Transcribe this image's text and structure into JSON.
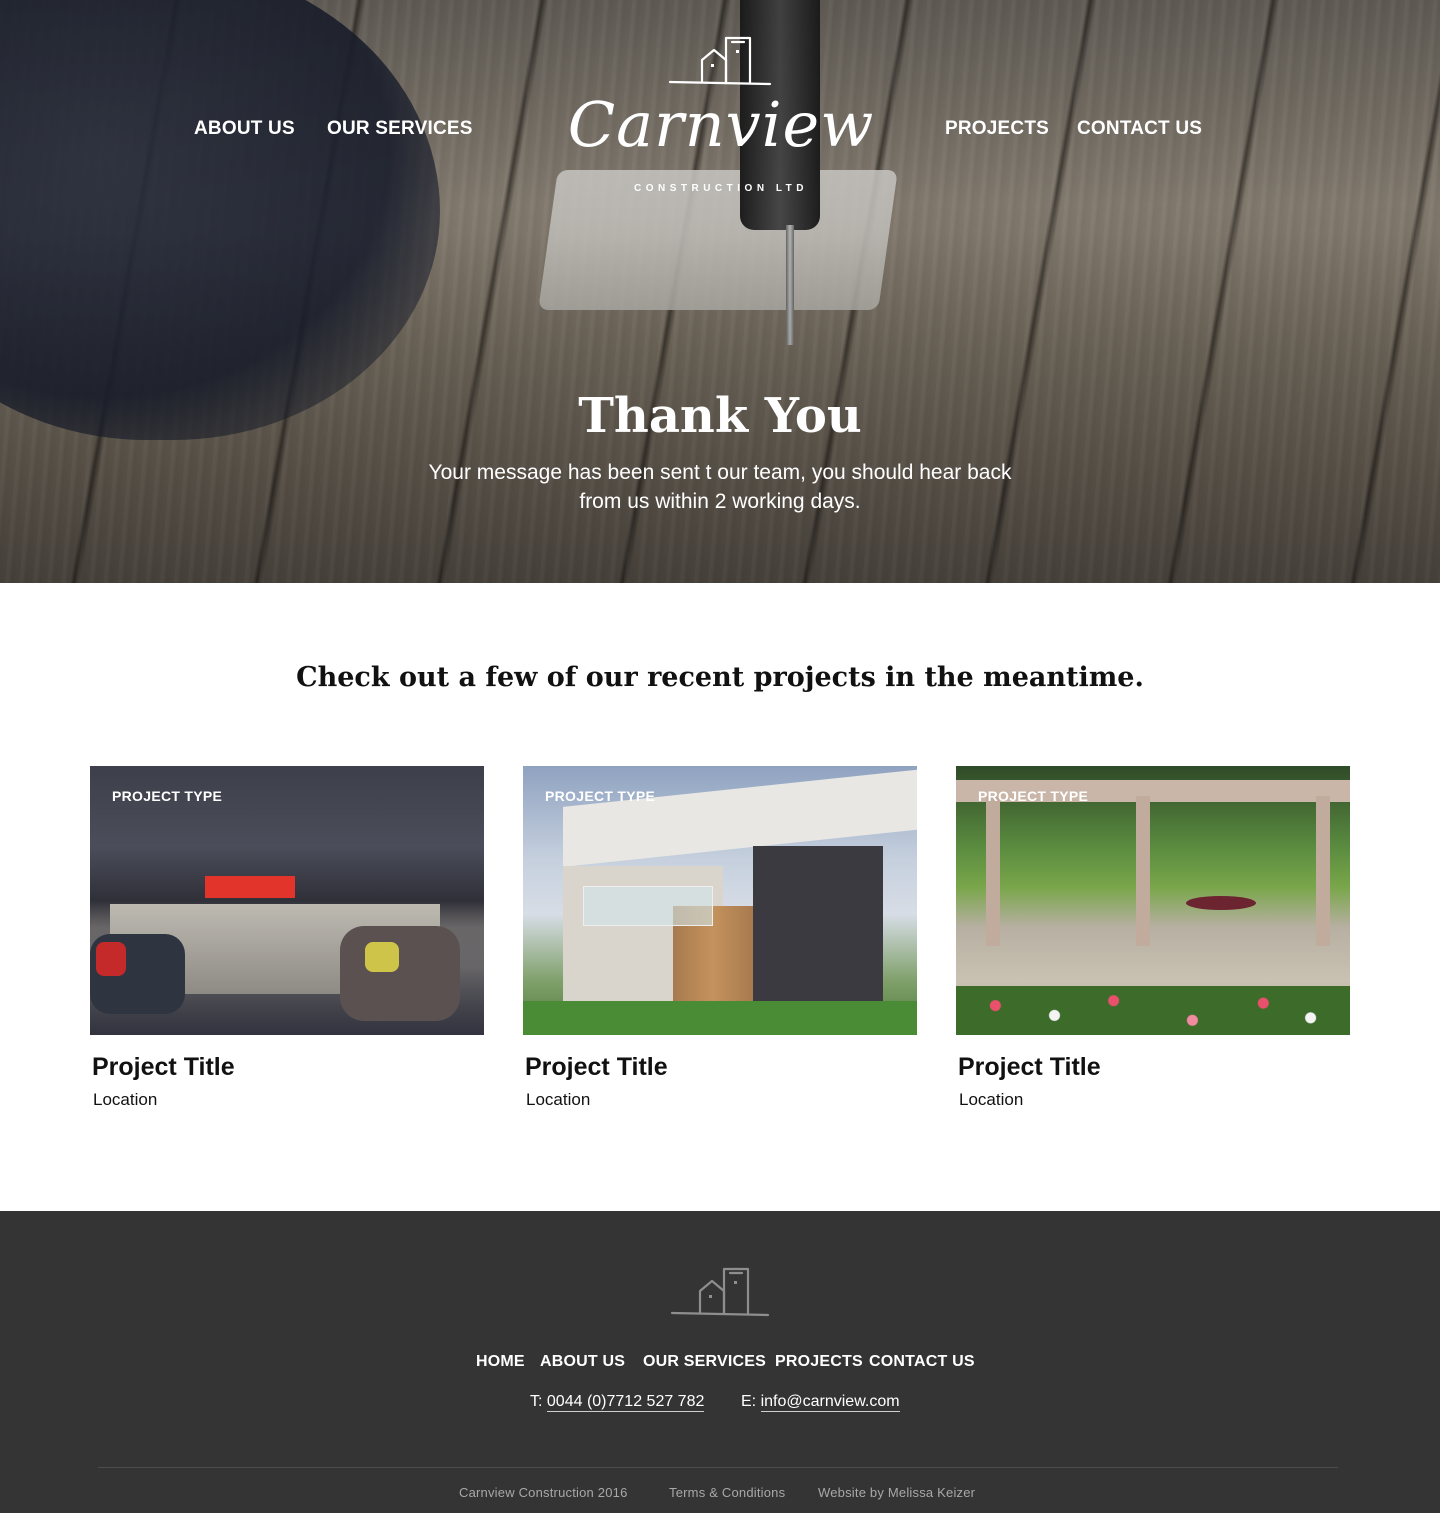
{
  "nav": {
    "about": "ABOUT US",
    "services": "OUR SERVICES",
    "projects": "PROJECTS",
    "contact": "CONTACT US"
  },
  "logo": {
    "name": "Carnview",
    "tagline": "CONSTRUCTION LTD"
  },
  "hero": {
    "title": "Thank You",
    "message_line1": "Your message has been sent t our team, you should hear back",
    "message_line2": "from us within 2 working days."
  },
  "projects": {
    "heading": "Check out a few of our recent projects in the meantime.",
    "items": [
      {
        "type": "PROJECT TYPE",
        "title": "Project Title",
        "location": "Location"
      },
      {
        "type": "PROJECT TYPE",
        "title": "Project Title",
        "location": "Location"
      },
      {
        "type": "PROJECT TYPE",
        "title": "Project Title",
        "location": "Location"
      }
    ]
  },
  "footer": {
    "nav": {
      "home": "HOME",
      "about": "ABOUT US",
      "services": "OUR SERVICES",
      "projects": "PROJECTS",
      "contact": "CONTACT US"
    },
    "phone_label": "T:",
    "phone": "0044 (0)7712 527 782",
    "email_label": "E:",
    "email": "info@carnview.com",
    "copyright": "Carnview Construction 2016",
    "terms": "Terms & Conditions",
    "credit": "Website by Melissa Keizer"
  },
  "colors": {
    "footer_bg": "#343434",
    "text_dark": "#111111",
    "white": "#ffffff"
  },
  "icons": {
    "logo": "house-outline-icon",
    "footer_logo": "house-outline-icon"
  }
}
